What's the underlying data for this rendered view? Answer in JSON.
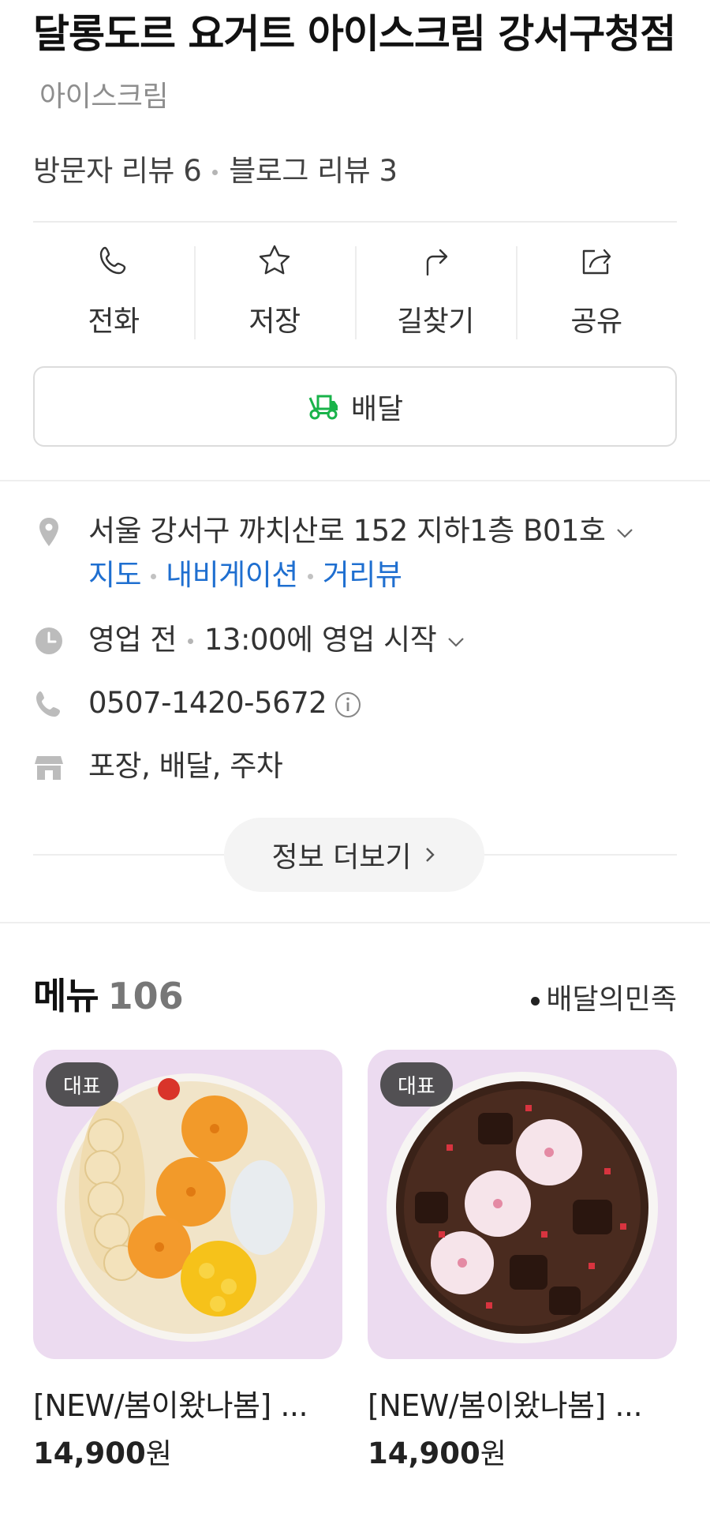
{
  "place": {
    "name": "달롱도르 요거트 아이스크림 강서구청점",
    "category": "아이스크림",
    "visitor_reviews": "방문자 리뷰 6",
    "blog_reviews": "블로그 리뷰 3"
  },
  "actions": [
    {
      "label": "전화",
      "icon": "phone-icon"
    },
    {
      "label": "저장",
      "icon": "star-icon"
    },
    {
      "label": "길찾기",
      "icon": "directions-icon"
    },
    {
      "label": "공유",
      "icon": "share-icon"
    }
  ],
  "delivery": {
    "label": "배달",
    "icon": "delivery-truck-icon",
    "color": "#19b34a"
  },
  "info": {
    "address": "서울 강서구 까치산로 152 지하1층 B01호",
    "links": [
      "지도",
      "내비게이션",
      "거리뷰"
    ],
    "hours_status": "영업 전",
    "hours_detail": "13:00에 영업 시작",
    "phone": "0507-1420-5672",
    "amenities": "포장, 배달, 주차",
    "more_label": "정보 더보기"
  },
  "menu": {
    "title": "메뉴",
    "count": "106",
    "source": "배달의민족",
    "items": [
      {
        "badge": "대표",
        "name": "[NEW/봄이왔나봄] ...",
        "price": "14,900",
        "currency": "원"
      },
      {
        "badge": "대표",
        "name": "[NEW/봄이왔나봄] ...",
        "price": "14,900",
        "currency": "원"
      }
    ]
  },
  "colors": {
    "link": "#1f6fd0",
    "thumb_bg": "#ecdbf0",
    "icon_gray": "#bcbcbc"
  }
}
